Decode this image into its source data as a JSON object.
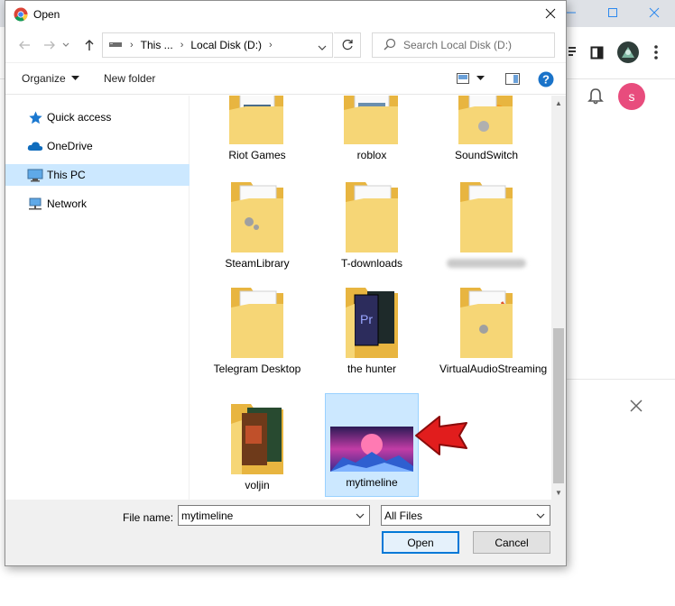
{
  "dialog": {
    "title": "Open",
    "colors": {
      "selection": "#cce8ff",
      "accent": "#0078d7",
      "folder": "#f5c542"
    }
  },
  "navigation": {
    "back_icon": "back-arrow-icon",
    "forward_icon": "forward-arrow-icon",
    "up_icon": "up-arrow-icon",
    "breadcrumb": [
      "This ...",
      "Local Disk (D:)"
    ],
    "search_placeholder": "Search Local Disk (D:)"
  },
  "commandbar": {
    "organize": "Organize",
    "new_folder": "New folder"
  },
  "sidebar": {
    "items": [
      {
        "label": "Quick access",
        "icon": "star-icon"
      },
      {
        "label": "OneDrive",
        "icon": "cloud-icon"
      },
      {
        "label": "This PC",
        "icon": "computer-icon",
        "selected": true
      },
      {
        "label": "Network",
        "icon": "network-icon"
      }
    ]
  },
  "files": [
    {
      "label": "Riot Games"
    },
    {
      "label": "roblox"
    },
    {
      "label": "SoundSwitch"
    },
    {
      "label": "SteamLibrary"
    },
    {
      "label": "T-downloads"
    },
    {
      "label": "",
      "blurred": true
    },
    {
      "label": "Telegram Desktop"
    },
    {
      "label": "the hunter"
    },
    {
      "label": "VirtualAudioStreaming"
    },
    {
      "label": "voljin"
    },
    {
      "label": "mytimeline",
      "selected": true
    }
  ],
  "footer": {
    "file_name_label": "File name:",
    "file_name_value": "mytimeline",
    "file_type": "All Files",
    "open_button": "Open",
    "cancel_button": "Cancel"
  },
  "background_app": {
    "avatar_letter": "s",
    "avatar_color": "#e84c7d"
  }
}
